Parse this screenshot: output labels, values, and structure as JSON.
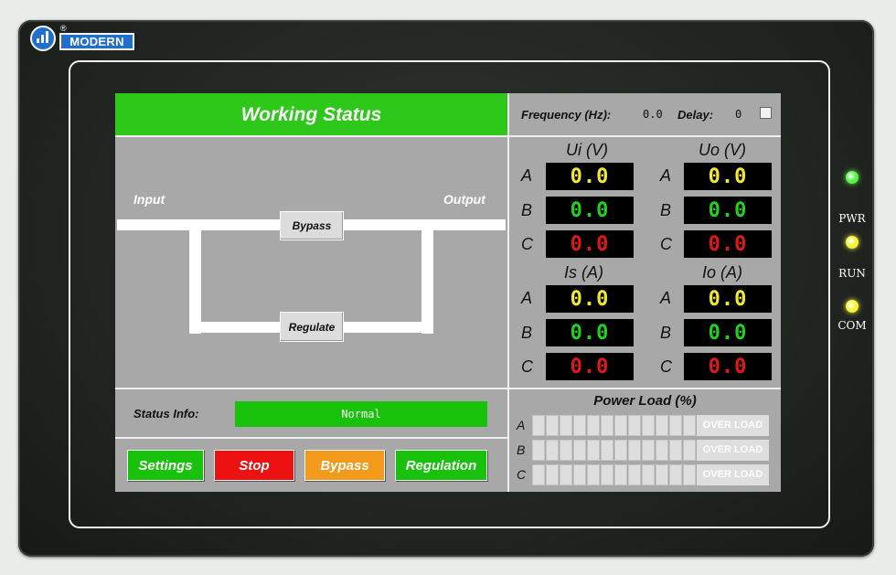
{
  "brand": {
    "name": "MODERN",
    "reg": "®"
  },
  "title": "Working Status",
  "header": {
    "frequency_label": "Frequency (Hz):",
    "frequency_value": "0.0",
    "delay_label": "Delay:",
    "delay_value": "0"
  },
  "diagram": {
    "input_label": "Input",
    "output_label": "Output",
    "bypass_label": "Bypass",
    "regulate_label": "Regulate"
  },
  "meters": {
    "ui_label": "Ui (V)",
    "uo_label": "Uo (V)",
    "is_label": "Is (A)",
    "io_label": "Io (A)",
    "phase_a": "A",
    "phase_b": "B",
    "phase_c": "C",
    "ui": [
      "0.0",
      "0.0",
      "0.0"
    ],
    "uo": [
      "0.0",
      "0.0",
      "0.0"
    ],
    "is": [
      "0.0",
      "0.0",
      "0.0"
    ],
    "io": [
      "0.0",
      "0.0",
      "0.0"
    ],
    "colors": {
      "a": "#f2e830",
      "b": "#22d01e",
      "c": "#e01818"
    }
  },
  "status": {
    "label": "Status Info:",
    "value": "Normal"
  },
  "buttons": {
    "settings": "Settings",
    "stop": "Stop",
    "bypass": "Bypass",
    "regulation": "Regulation",
    "colors": {
      "settings": "#18c20a",
      "stop": "#ee1111",
      "bypass": "#f39a1c",
      "regulation": "#18c20a"
    }
  },
  "power_load": {
    "title": "Power Load (%)",
    "rows": [
      "A",
      "B",
      "C"
    ],
    "over_label": "OVER LOAD",
    "levels": [
      0,
      0,
      0
    ]
  },
  "indicators": {
    "pwr": "PWR",
    "run": "RUN",
    "com": "COM",
    "colors": {
      "pwr": "#5cf24a",
      "run": "#f5f23a",
      "com": "#f5f23a"
    }
  }
}
